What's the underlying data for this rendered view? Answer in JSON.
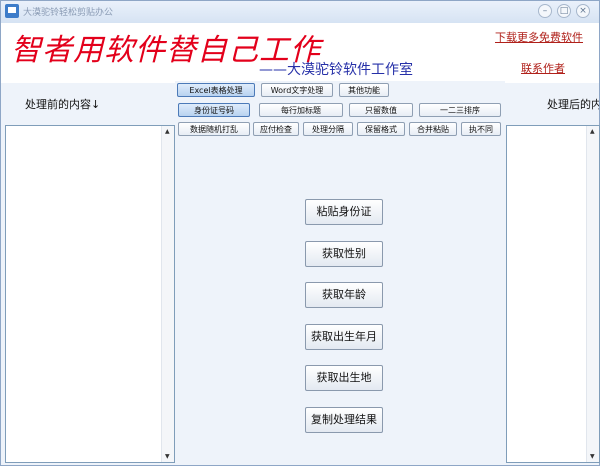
{
  "window": {
    "title": "大漠驼铃轻松剪贴办公"
  },
  "banner": {
    "slogan": "智者用软件替自己工作",
    "studio": "——大漠驼铃软件工作室",
    "download_link": "下载更多免费软件",
    "contact_link": "联系作者"
  },
  "left_panel": {
    "label": "处理前的内容↓"
  },
  "right_panel": {
    "label": "处理后的内容↓"
  },
  "tabs": [
    {
      "label": "Excel表格处理"
    },
    {
      "label": "Word文字处理"
    },
    {
      "label": "其他功能"
    }
  ],
  "tools_row1": [
    {
      "label": "身份证号码"
    },
    {
      "label": "每行加标题"
    },
    {
      "label": "只留数值"
    },
    {
      "label": "一二三排序"
    }
  ],
  "tools_row2": [
    {
      "label": "数据随机打乱"
    },
    {
      "label": "应付检查"
    },
    {
      "label": "处理分隔"
    },
    {
      "label": "保留格式"
    },
    {
      "label": "合并粘贴"
    },
    {
      "label": "执不同"
    }
  ],
  "actions": [
    {
      "label": "粘贴身份证"
    },
    {
      "label": "获取性别"
    },
    {
      "label": "获取年龄"
    },
    {
      "label": "获取出生年月"
    },
    {
      "label": "获取出生地"
    },
    {
      "label": "复制处理结果"
    }
  ],
  "colors": {
    "slogan": "#e3001b",
    "studio": "#2630a8",
    "link": "#b0201a"
  }
}
